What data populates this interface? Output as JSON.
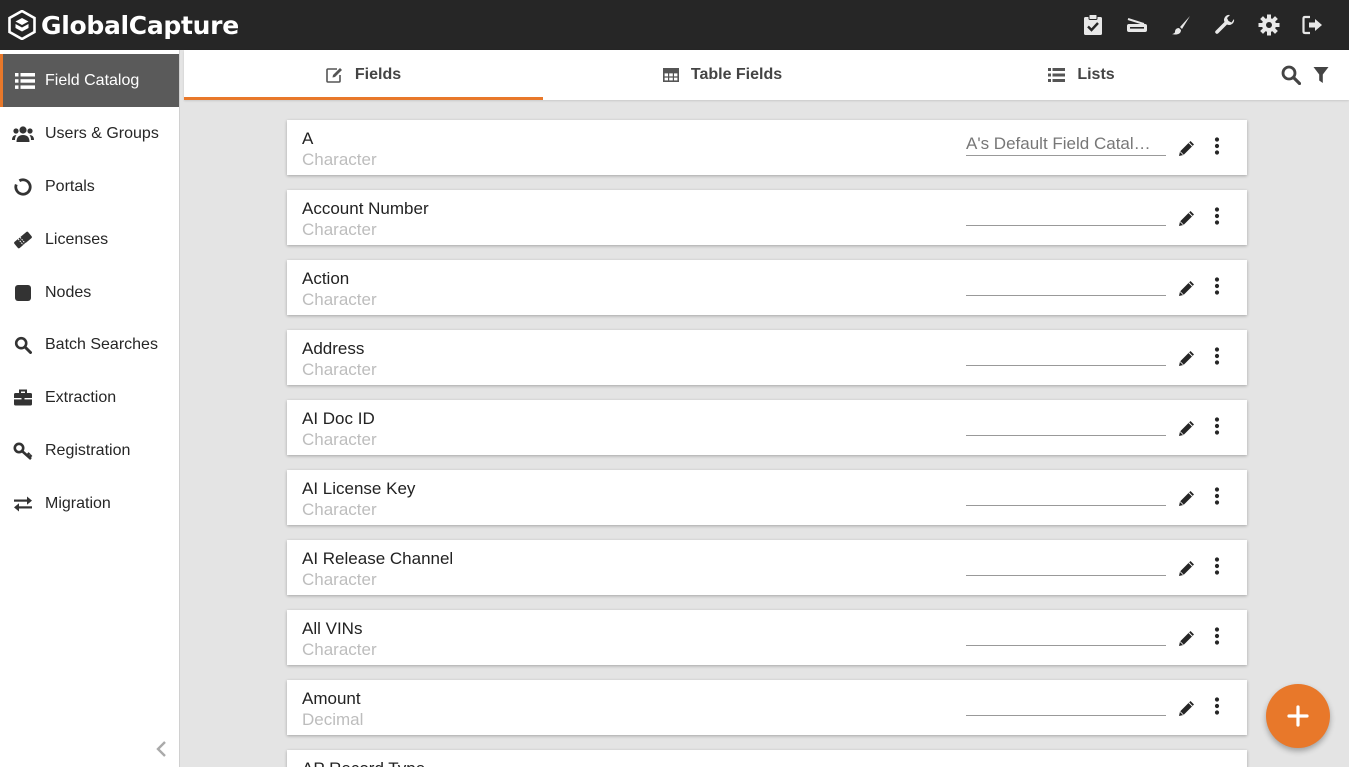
{
  "app": {
    "title": "GlobalCapture"
  },
  "colors": {
    "accent": "#e8782a",
    "topbar": "#262626",
    "active_nav": "#5a5a5a"
  },
  "topbar": {
    "icons": [
      "tasks-icon",
      "scanner-icon",
      "brush-icon",
      "wrench-icon",
      "gear-icon",
      "logout-icon"
    ]
  },
  "sidebar": {
    "items": [
      {
        "label": "Field Catalog",
        "icon": "list-icon",
        "active": true
      },
      {
        "label": "Users & Groups",
        "icon": "users-icon"
      },
      {
        "label": "Portals",
        "icon": "portal-ring-icon"
      },
      {
        "label": "Licenses",
        "icon": "ticket-icon"
      },
      {
        "label": "Nodes",
        "icon": "node-square-icon"
      },
      {
        "label": "Batch Searches",
        "icon": "search-icon"
      },
      {
        "label": "Extraction",
        "icon": "briefcase-icon"
      },
      {
        "label": "Registration",
        "icon": "key-icon"
      },
      {
        "label": "Migration",
        "icon": "exchange-icon"
      }
    ]
  },
  "tabs": [
    {
      "label": "Fields",
      "icon": "edit-icon",
      "active": true
    },
    {
      "label": "Table Fields",
      "icon": "table-icon"
    },
    {
      "label": "Lists",
      "icon": "list-icon"
    }
  ],
  "fields": [
    {
      "name": "A",
      "type": "Character",
      "catalog": "A's Default Field Catal…"
    },
    {
      "name": "Account Number",
      "type": "Character",
      "catalog": ""
    },
    {
      "name": "Action",
      "type": "Character",
      "catalog": ""
    },
    {
      "name": "Address",
      "type": "Character",
      "catalog": ""
    },
    {
      "name": "AI Doc ID",
      "type": "Character",
      "catalog": ""
    },
    {
      "name": "AI License Key",
      "type": "Character",
      "catalog": ""
    },
    {
      "name": "AI Release Channel",
      "type": "Character",
      "catalog": ""
    },
    {
      "name": "All VINs",
      "type": "Character",
      "catalog": ""
    },
    {
      "name": "Amount",
      "type": "Decimal",
      "catalog": ""
    },
    {
      "name": "AP Record Type",
      "type": "",
      "catalog": ""
    }
  ]
}
